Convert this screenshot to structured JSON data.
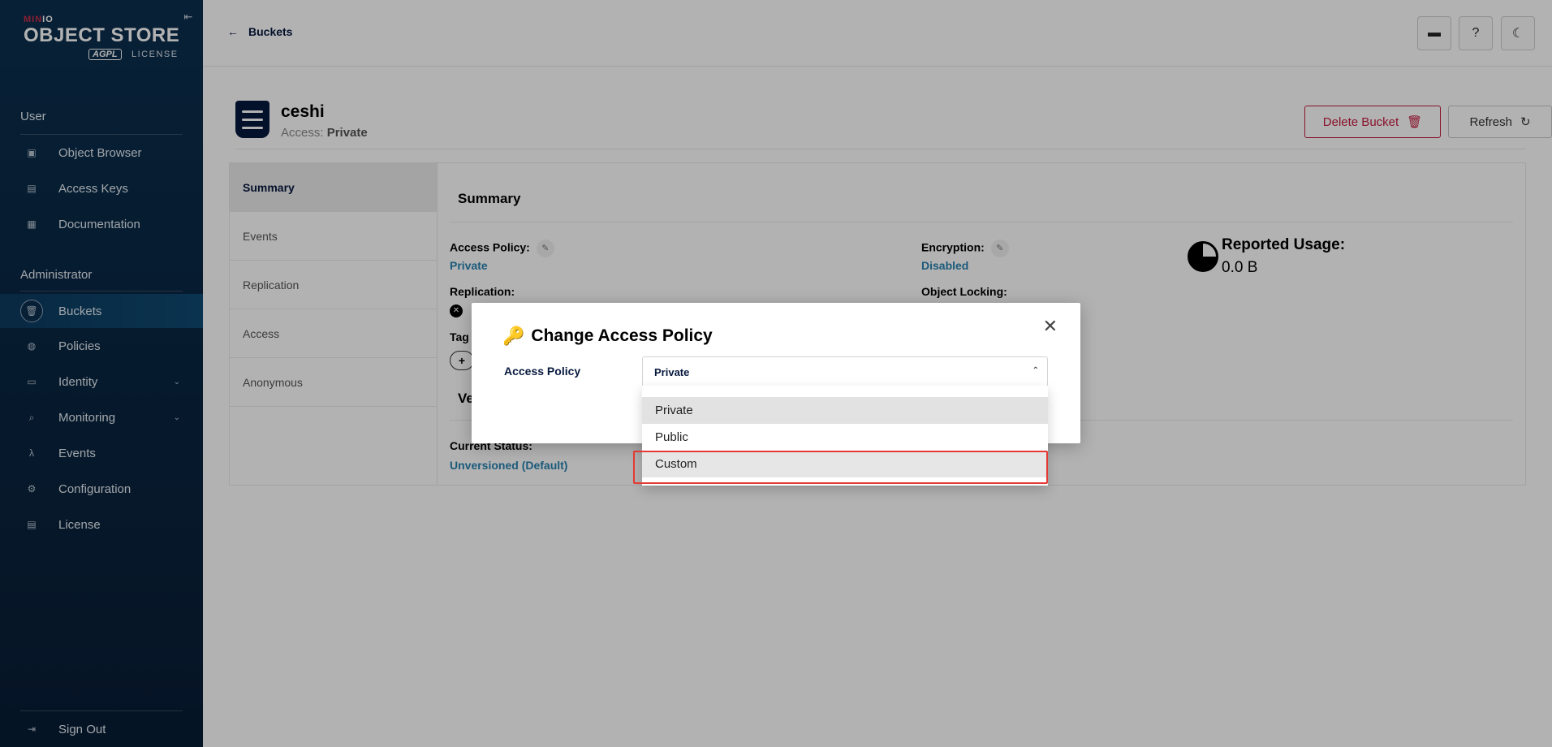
{
  "brand": {
    "minio": "MIN",
    "minio_io": "IO",
    "product": "OBJECT STORE",
    "badge": "AGPL",
    "license": "LICENSE"
  },
  "sidebar": {
    "user_title": "User",
    "user_items": [
      {
        "label": "Object Browser",
        "icon": "object-browser-icon"
      },
      {
        "label": "Access Keys",
        "icon": "access-keys-icon"
      },
      {
        "label": "Documentation",
        "icon": "documentation-icon"
      }
    ],
    "admin_title": "Administrator",
    "admin_items": [
      {
        "label": "Buckets",
        "icon": "bucket-icon"
      },
      {
        "label": "Policies",
        "icon": "policies-icon"
      },
      {
        "label": "Identity",
        "icon": "identity-icon"
      },
      {
        "label": "Monitoring",
        "icon": "monitoring-icon"
      },
      {
        "label": "Events",
        "icon": "lambda-icon"
      },
      {
        "label": "Configuration",
        "icon": "gear-icon"
      },
      {
        "label": "License",
        "icon": "license-icon"
      }
    ],
    "sign_out": "Sign Out"
  },
  "header": {
    "back_label": "Buckets"
  },
  "bucket": {
    "name": "ceshi",
    "access_prefix": "Access:",
    "access_value": "Private",
    "delete_label": "Delete Bucket",
    "refresh_label": "Refresh"
  },
  "tabs": [
    "Summary",
    "Events",
    "Replication",
    "Access",
    "Anonymous"
  ],
  "summary": {
    "title": "Summary",
    "access_policy_label": "Access Policy:",
    "access_policy_value": "Private",
    "encryption_label": "Encryption:",
    "encryption_value": "Disabled",
    "replication_label": "Replication:",
    "object_locking_label": "Object Locking:",
    "tags_label": "Tag",
    "versioning_label": "Ve",
    "current_status_label": "Current Status:",
    "current_status_value": "Unversioned (Default)",
    "usage_title": "Reported Usage:",
    "usage_value": "0.0 B"
  },
  "modal": {
    "title": "Change Access Policy",
    "field_label": "Access Policy",
    "selected": "Private",
    "options": [
      "Private",
      "Public",
      "Custom"
    ]
  }
}
